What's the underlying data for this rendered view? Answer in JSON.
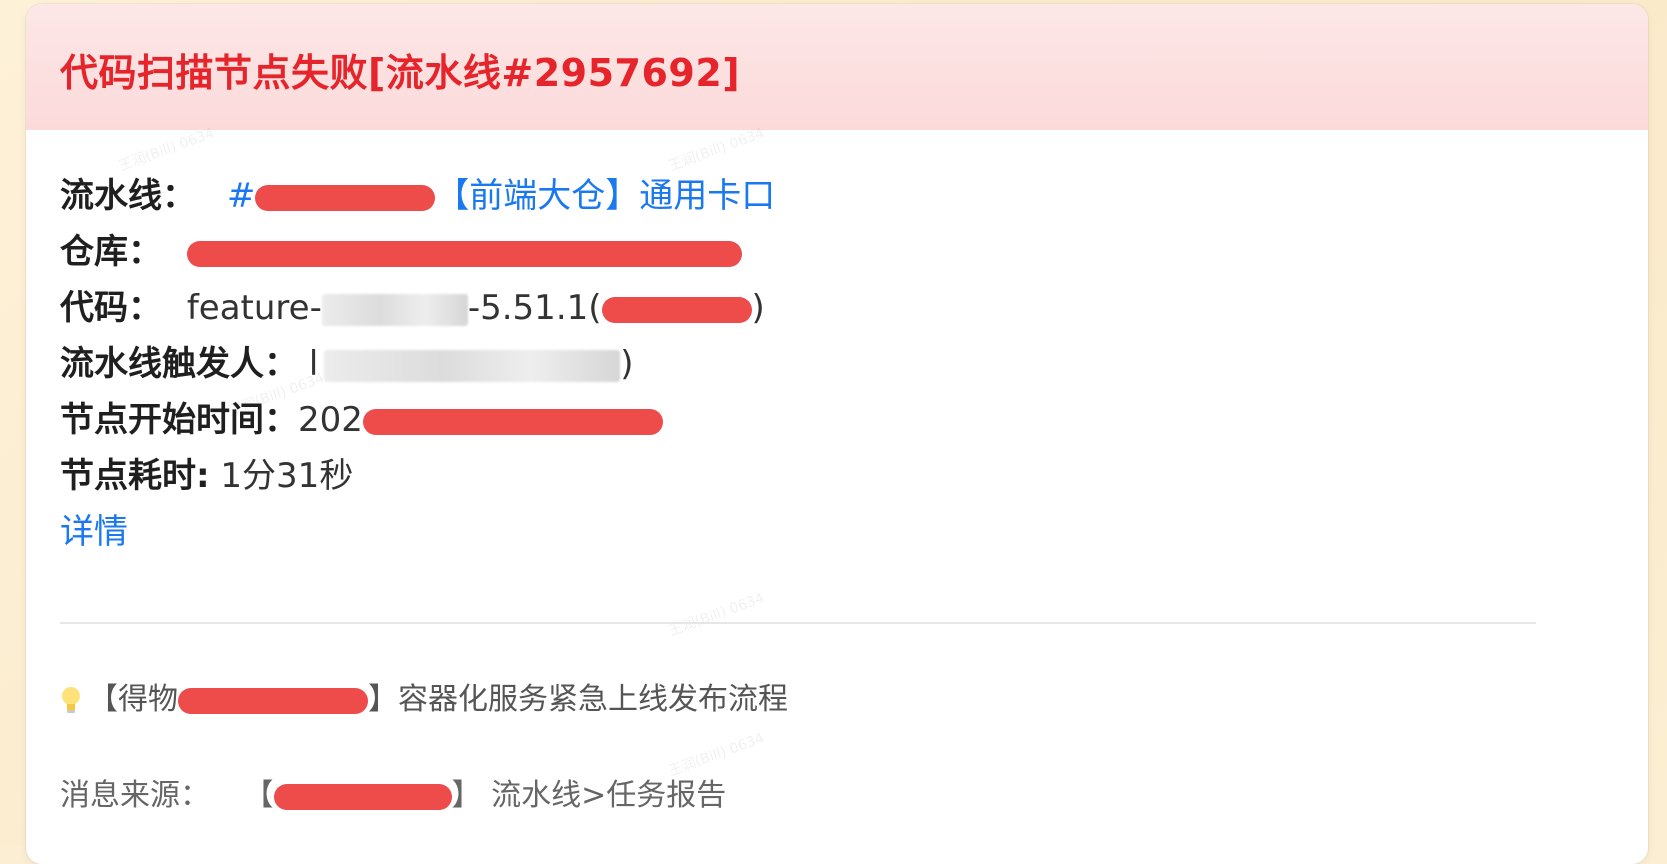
{
  "card": {
    "title": "代码扫描节点失败[流水线#2957692]"
  },
  "fields": {
    "pipeline": {
      "label": "流水线：",
      "prefix": "#",
      "link_text": "【前端大仓】通用卡口"
    },
    "repo": {
      "label": "仓库："
    },
    "code": {
      "label": "代码：",
      "branch_prefix": "feature-",
      "branch_suffix": "-5.51.1(",
      "close_paren": ")"
    },
    "trigger": {
      "label": "流水线触发人：",
      "value_prefix": "l",
      "close_paren": ")"
    },
    "start_time": {
      "label": "节点开始时间：",
      "value_prefix": "202"
    },
    "duration": {
      "label": "节点耗时:",
      "value": "1分31秒"
    },
    "details_link": "详情"
  },
  "tip": {
    "icon": "lightbulb-icon",
    "prefix": "【得物",
    "suffix": "】容器化服务紧急上线发布流程"
  },
  "source": {
    "label": "消息来源：",
    "bracket_open": "【",
    "bracket_close": "】",
    "suffix": "流水线>任务报告"
  },
  "colors": {
    "title": "#e5252b",
    "link": "#1a78f0",
    "header_bg": "#fde7e7",
    "page_bg": "#fbeed3",
    "redaction": "#ee4b4b"
  }
}
